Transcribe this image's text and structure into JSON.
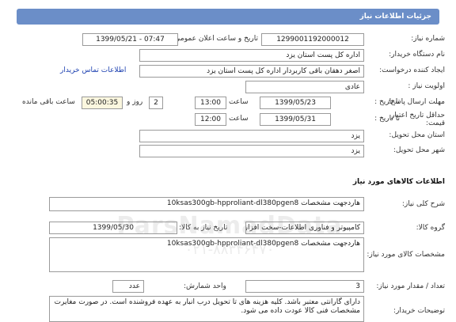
{
  "header": {
    "title": "جزئیات اطلاعات نیاز"
  },
  "need_number": {
    "label": "شماره نیاز:",
    "value": "1299001192000012"
  },
  "announce_datetime": {
    "label": "تاریخ و ساعت اعلان عمومی:",
    "value": "1399/05/21 - 07:47"
  },
  "buyer_org": {
    "label": "نام دستگاه خریدار:",
    "value": "اداره کل پست استان یزد"
  },
  "requester": {
    "label": "ایجاد کننده درخواست:",
    "value": "اصغر دهقان باقی کاربردار  اداره کل پست استان یزد",
    "contact_link": "اطلاعات تماس خریدار"
  },
  "priority": {
    "label": "اولویت نیاز :",
    "value": "عادی"
  },
  "reply_deadline": {
    "label": "مهلت ارسال پاسخ:",
    "to_date_label": "تا تاریخ :",
    "date": "1399/05/23",
    "time_label": "ساعت",
    "time": "13:00",
    "days": "2",
    "days_label": "روز و",
    "remaining": "05:00:35",
    "remaining_label": "ساعت باقی مانده"
  },
  "price_validity": {
    "label": "حداقل تاریخ اعتبار قیمت:",
    "to_date_label": "تا تاریخ :",
    "date": "1399/05/31",
    "time_label": "ساعت",
    "time": "12:00"
  },
  "delivery_province": {
    "label": "استان محل تحویل:",
    "value": "یزد"
  },
  "delivery_city": {
    "label": "شهر محل تحویل:",
    "value": "یزد"
  },
  "goods_section": {
    "title": "اطلاعات کالاهای مورد نیاز"
  },
  "general_desc": {
    "label": "شرح کلی نیاز:",
    "value": "هاردجهت  مشخصات 10ksas300gb-hpproliant-dl380pgen8"
  },
  "goods_group": {
    "label": "گروه کالا:",
    "value": "کامپیوتر و فناوری اطلاعات-سخت افزار",
    "need_date_label": "تاریخ نیاز به کالا:",
    "need_date": "1399/05/30"
  },
  "goods_spec": {
    "label": "مشخصات کالای مورد نیاز:",
    "value": "هاردجهت  مشخصات 10ksas300gb-hpproliant-dl380pgen8"
  },
  "quantity": {
    "label": "تعداد / مقدار مورد نیاز:",
    "value": "3",
    "unit_label": "واحد شمارش:",
    "unit": "عدد"
  },
  "buyer_notes": {
    "label": "توضیحات خریدار:",
    "value": "دارای گارانتی معتبر باشد. کلیه هزینه های تا تحویل درب انبار به عهده فروشنده است. در صورت مغایرت مشخصات فنی کالا عودت داده می شود."
  },
  "watermark": {
    "text": "ParsNamadData",
    "sub": "۰۲۱-۸۸۳۴۶۴۷۰"
  },
  "colors": {
    "header_bar": "#6b8ec8",
    "link": "#1b3fb0"
  }
}
